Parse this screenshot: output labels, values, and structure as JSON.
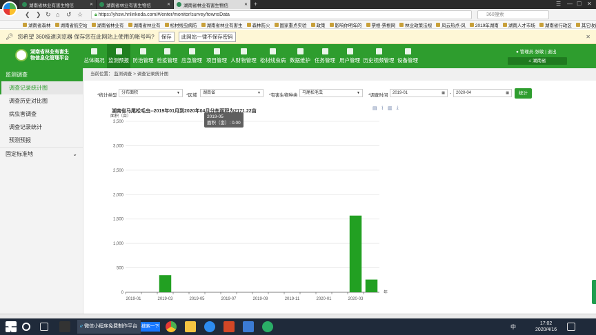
{
  "browser": {
    "tabs": [
      {
        "title": "湖南省林业有害生物信",
        "active": false
      },
      {
        "title": "湖南省林业有害生物信",
        "active": false
      },
      {
        "title": "湖南省林业有害生物信",
        "active": true
      }
    ],
    "url": "https://yhsw.hnlinkeda.com/#/enter/monitor/survey/townsData",
    "search_placeholder": "360搜索",
    "bookmarks": [
      "湖南省森林",
      "湖南省航空站",
      "湖南省林业有",
      "湖南省林业有",
      "松材线虫病防",
      "湖南省林业有害生",
      "森林防火",
      "国家重点实验",
      "政策",
      "影响你明年的",
      "票根-票根网",
      "林业政策法规",
      "风云热点-风",
      "2019年湖南",
      "湖南人才市场",
      "湖南省行政区",
      "其它收藏"
    ],
    "password_prompt": {
      "message": "您希望 360极速浏览器 保存您在此网站上使用的帐号吗?",
      "save": "保存",
      "never": "此网站一律不保存密码"
    }
  },
  "app": {
    "brand_line1": "湖南省林业有害生",
    "brand_line2": "物信息化管理平台",
    "nav": [
      "总体概况",
      "监测预报",
      "防治管理",
      "检疫管理",
      "应急管理",
      "项目管理",
      "人财物管理",
      "松材线虫病",
      "数据维护",
      "任务管理",
      "用户管理",
      "历史视频管理",
      "设备管理"
    ],
    "active_nav": 1,
    "user": "管理员-张敏 | 退出",
    "region": "湖南省"
  },
  "sidebar": {
    "header": "监测调查",
    "items": [
      "调查记录统计图",
      "调查历史对比图",
      "病虫害调查",
      "调查记录统计",
      "预测预报"
    ],
    "active": 0,
    "section2": "固定标准地"
  },
  "breadcrumb": "当前位置：  监测调查 > 调查记录统计图",
  "filters": {
    "type_label": "*统计类型",
    "type_value": "分布面积",
    "area_label": "*区域",
    "area_value": "湖南省",
    "species_label": "*有害生物种类",
    "species_value": "马尾松毛虫",
    "time_label": "*调查时间",
    "start": "2019-01",
    "end": "2020-04",
    "dash": "-",
    "button": "统计"
  },
  "tooltip": {
    "title": "2019-05",
    "text": "面积（亩）: 0.00"
  },
  "chart_data": {
    "type": "bar",
    "title": "湖南省马尾松毛虫--2019年01月到2020年04月分布面积为2171.22亩",
    "ylabel": "面积（亩）",
    "xlabel": "年",
    "ylim": [
      0,
      3500
    ],
    "yticks": [
      0,
      500,
      1000,
      1500,
      2000,
      2500,
      3000,
      3500
    ],
    "ytick_labels": [
      "0",
      "500",
      "1,000",
      "1,500",
      "2,000",
      "2,500",
      "3,000",
      "3,500"
    ],
    "xtick_labels": [
      "2019-01",
      "2019-03",
      "2019-05",
      "2019-07",
      "2019-09",
      "2019-11",
      "2020-01",
      "2020-03"
    ],
    "categories": [
      "2019-01",
      "2019-02",
      "2019-03",
      "2019-04",
      "2019-05",
      "2019-06",
      "2019-07",
      "2019-08",
      "2019-09",
      "2019-10",
      "2019-11",
      "2019-12",
      "2020-01",
      "2020-02",
      "2020-03",
      "2020-04"
    ],
    "values": [
      0,
      0,
      350,
      0,
      0,
      0,
      0,
      0,
      0,
      0,
      0,
      0,
      0,
      0,
      1570,
      260
    ],
    "color": "#22a022",
    "grid": true
  },
  "taskbar": {
    "app_title": "微信小程序免费制作平台",
    "button": "搜索一下",
    "time": "17:02",
    "date": "2020/4/16",
    "ime": "中"
  }
}
